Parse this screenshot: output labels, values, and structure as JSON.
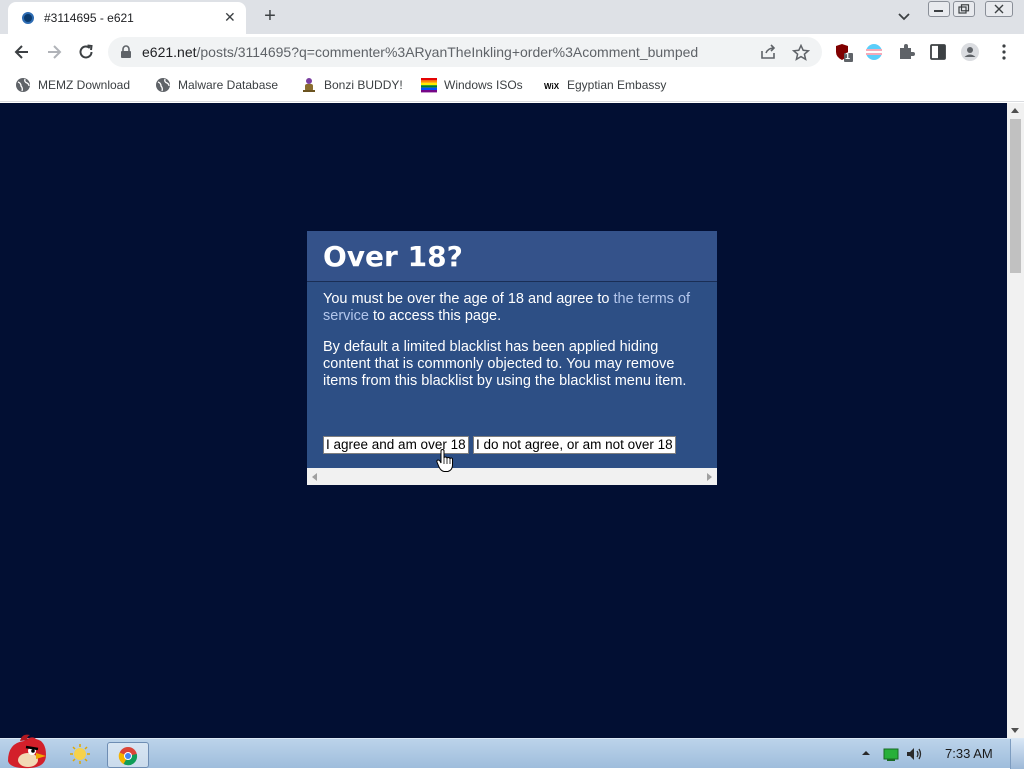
{
  "tab": {
    "title": "#3114695 - e621",
    "favicon": "e621-icon",
    "close": "✕",
    "new_tab": "+"
  },
  "address": {
    "host": "e621.net",
    "path": "/posts/3114695?q=commenter%3ARyanTheInkling+order%3Acomment_bumped"
  },
  "extensions": {
    "badge": "1"
  },
  "bookmarks": [
    {
      "label": "MEMZ Download",
      "icon": "globe-icon"
    },
    {
      "label": "Malware Database",
      "icon": "globe-icon"
    },
    {
      "label": "Bonzi BUDDY!",
      "icon": "bonzi-icon"
    },
    {
      "label": "Windows ISOs",
      "icon": "rainbow-flag-icon"
    },
    {
      "label": "Egyptian Embassy",
      "icon": "wix-icon"
    }
  ],
  "dialog": {
    "title": "Over 18?",
    "p1_before": "You must be over the age of 18 and agree to ",
    "p1_link": "the terms of service",
    "p1_after": " to access this page.",
    "p2": "By default a limited blacklist has been applied hiding content that is commonly objected to. You may remove items from this blacklist by using the blacklist menu item.",
    "agree_button": "I agree and am over 18",
    "disagree_button": "I do not agree, or am not over 18"
  },
  "taskbar": {
    "clock": "7:33 AM"
  },
  "colors": {
    "page_bg": "#020f33",
    "dialog_bg": "#2d4f85",
    "link": "#b4c7ec"
  }
}
